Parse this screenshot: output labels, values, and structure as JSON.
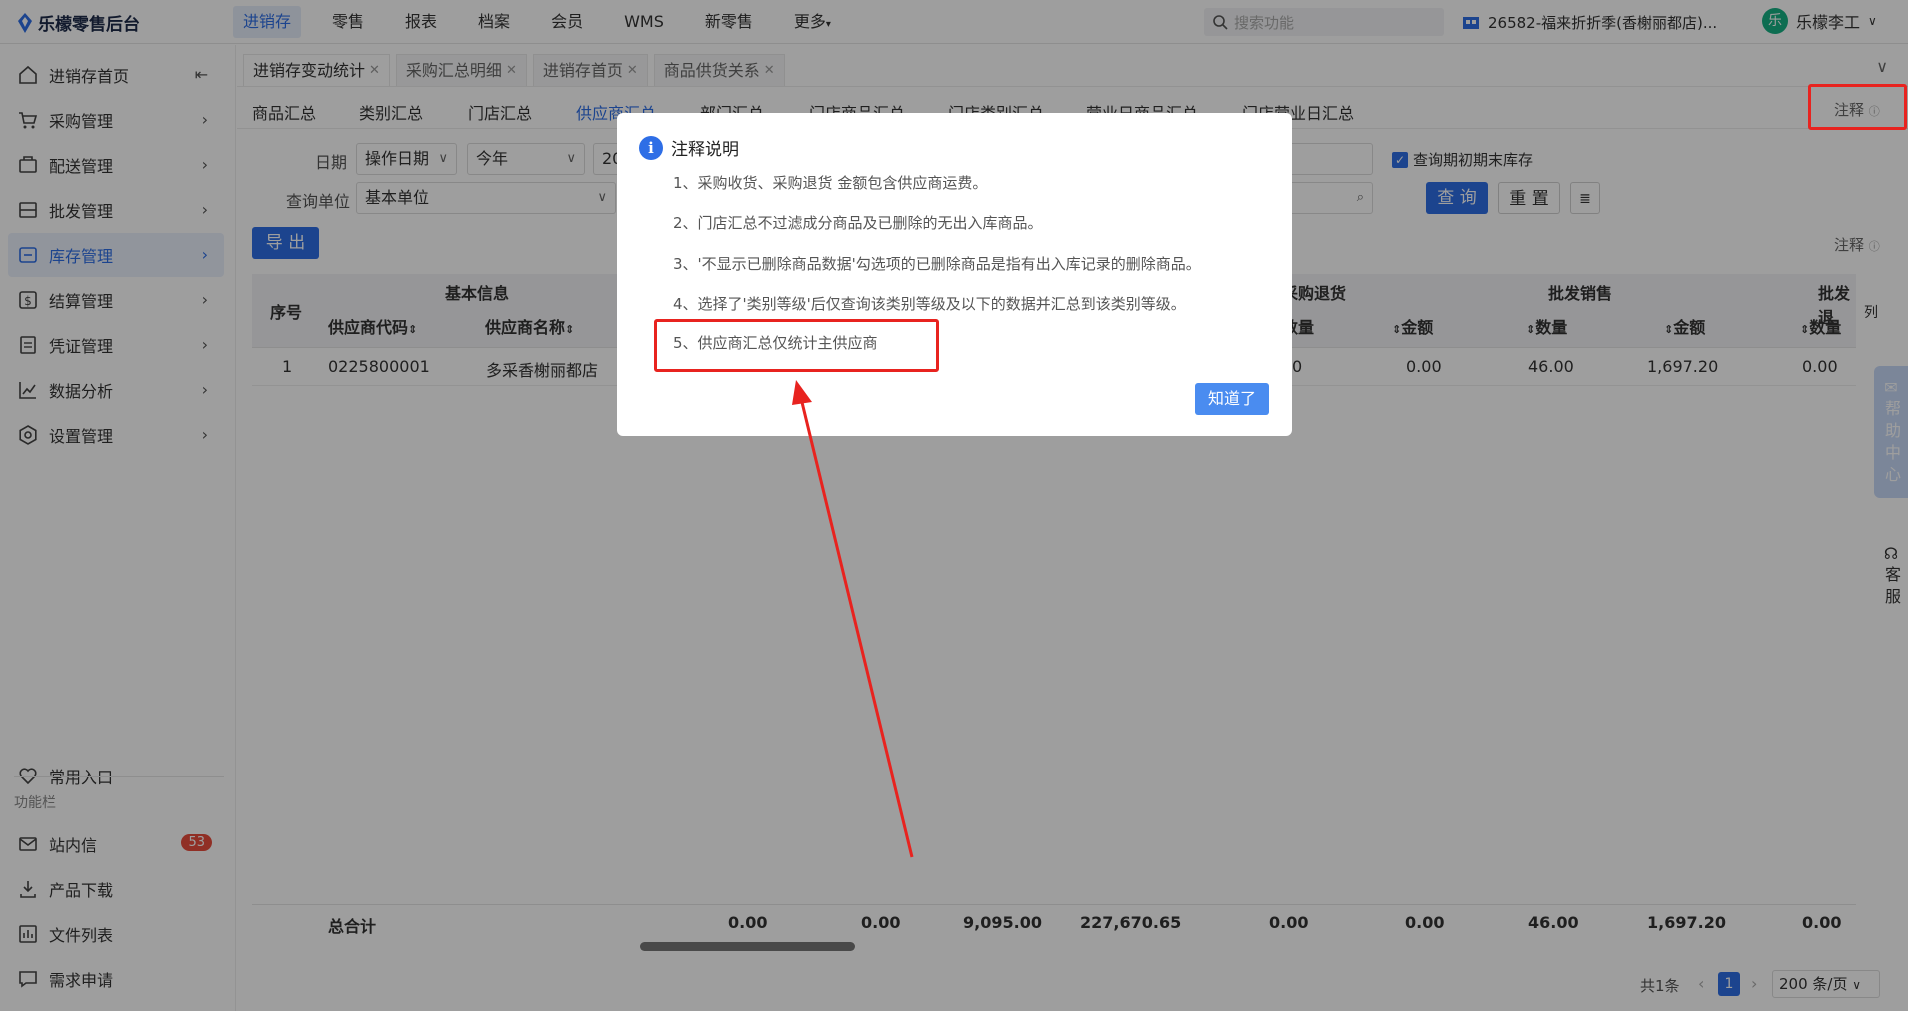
{
  "app": {
    "title": "乐檬零售后台"
  },
  "topnav": [
    "进销存",
    "零售",
    "报表",
    "档案",
    "会员",
    "WMS",
    "新零售",
    "更多"
  ],
  "search": {
    "placeholder": "搜索功能"
  },
  "store": "26582-福来折折季(香榭丽都店)...",
  "user": {
    "avatar": "乐",
    "name": "乐檬李工"
  },
  "sidebar": {
    "items": [
      {
        "label": "进销存首页"
      },
      {
        "label": "采购管理"
      },
      {
        "label": "配送管理"
      },
      {
        "label": "批发管理"
      },
      {
        "label": "库存管理"
      },
      {
        "label": "结算管理"
      },
      {
        "label": "凭证管理"
      },
      {
        "label": "数据分析"
      },
      {
        "label": "设置管理"
      }
    ],
    "common": "常用入口",
    "func_caption": "功能栏",
    "func_items": [
      {
        "label": "站内信",
        "badge": "53"
      },
      {
        "label": "产品下载"
      },
      {
        "label": "文件列表"
      },
      {
        "label": "需求申请"
      }
    ]
  },
  "tabs": [
    "进销存变动统计",
    "采购汇总明细",
    "进销存首页",
    "商品供货关系"
  ],
  "subtabs": [
    "商品汇总",
    "类别汇总",
    "门店汇总",
    "供应商汇总",
    "部门汇总",
    "门店商品汇总",
    "门店类别汇总",
    "营业日商品汇总",
    "门店营业日汇总"
  ],
  "annot": "注释",
  "form": {
    "date_label": "日期",
    "date_type": "操作日期",
    "date_range": "今年",
    "date_value": "20",
    "unit_label": "查询单位",
    "unit_value": "基本单位",
    "checkbox_label": "查询期初期末库存",
    "query_btn": "查 询",
    "reset_btn": "重 置",
    "export_btn": "导 出"
  },
  "table": {
    "col_seq": "序号",
    "group_basic": "基本信息",
    "group_purchase_return": "采购退货",
    "group_wholesale": "批发销售",
    "group_wholesale_return": "批发退",
    "col_supplier_code": "供应商代码",
    "col_supplier_name": "供应商名称",
    "col_qty": "数量",
    "col_amount": "金额",
    "col_column": "列",
    "row": {
      "seq": "1",
      "code": "0225800001",
      "name": "多采香榭丽都店",
      "c1": "0",
      "c2": "0.00",
      "c3": "46.00",
      "c4": "1,697.20",
      "c5": "0.00"
    },
    "total_label": "总合计",
    "totals": [
      "0.00",
      "0.00",
      "9,095.00",
      "227,670.65",
      "0.00",
      "0.00",
      "46.00",
      "1,697.20",
      "0.00"
    ]
  },
  "pagination": {
    "total": "共1条",
    "page": "1",
    "page_size": "200 条/页"
  },
  "right_float": {
    "help": "帮助中心",
    "kefu": "客服"
  },
  "modal": {
    "title": "注释说明",
    "lines": [
      "1、采购收货、采购退货 金额包含供应商运费。",
      "2、门店汇总不过滤成分商品及已删除的无出入库商品。",
      "3、'不显示已删除商品数据'勾选项的已删除商品是指有出入库记录的删除商品。",
      "4、选择了'类别等级'后仅查询该类别等级及以下的数据并汇总到该类别等级。",
      "5、供应商汇总仅统计主供应商"
    ],
    "ok": "知道了"
  },
  "colors": {
    "accent": "#2e6ee6",
    "highlight": "#e8231f"
  }
}
